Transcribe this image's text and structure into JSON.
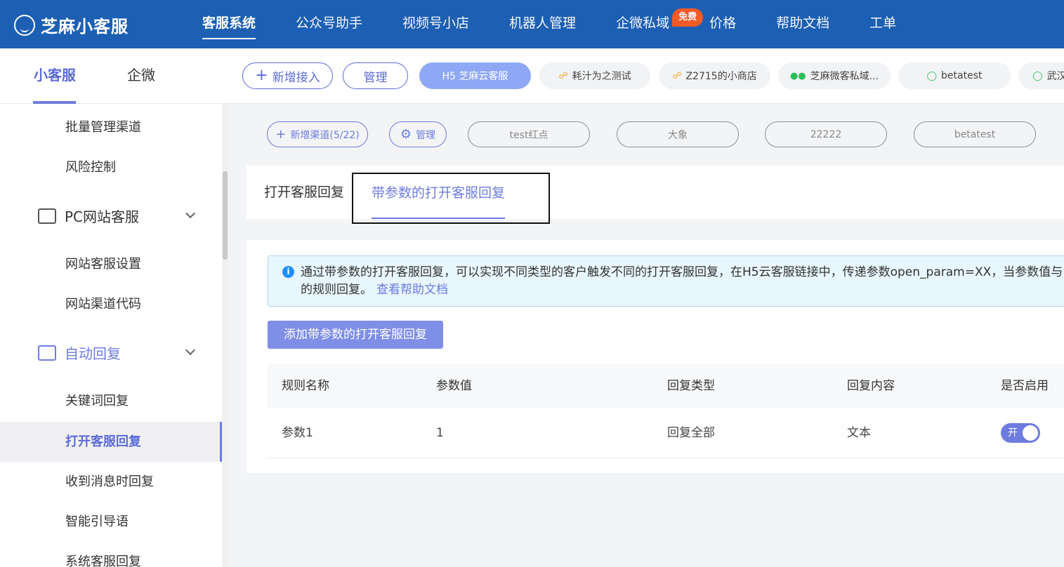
{
  "brand": {
    "name": "芝麻小客服"
  },
  "topnav": [
    {
      "label": "客服系统",
      "active": true
    },
    {
      "label": "公众号助手"
    },
    {
      "label": "视频号小店"
    },
    {
      "label": "机器人管理"
    },
    {
      "label": "企微私域",
      "badge": "免费"
    },
    {
      "label": "价格"
    },
    {
      "label": "帮助文档"
    },
    {
      "label": "工单"
    }
  ],
  "product_tabs": [
    "小客服",
    "企微"
  ],
  "accounts": {
    "add_label": "新增接入",
    "manage_label": "管理",
    "items": [
      "H5 芝麻云客服",
      "耗汁为之测试",
      "Z2715的小商店",
      "芝麻微客私域...",
      "betatest",
      "武汉"
    ]
  },
  "sidebar": {
    "items": [
      {
        "label": "批量管理渠道"
      },
      {
        "label": "风险控制"
      },
      {
        "label": "PC网站客服",
        "group": true,
        "icon": "website-icon"
      },
      {
        "label": "网站客服设置"
      },
      {
        "label": "网站渠道代码"
      },
      {
        "label": "自动回复",
        "group": true,
        "icon": "message-icon"
      },
      {
        "label": "关键词回复"
      },
      {
        "label": "打开客服回复",
        "active": true
      },
      {
        "label": "收到消息时回复"
      },
      {
        "label": "智能引导语"
      },
      {
        "label": "系统客服回复"
      }
    ]
  },
  "channels": {
    "add_label": "新增渠道(5/22)",
    "manage_label": "管理",
    "items": [
      "test红点",
      "大象",
      "22222",
      "betatest"
    ]
  },
  "reply_tabs": [
    "打开客服回复",
    "带参数的打开客服回复"
  ],
  "info": {
    "text": "通过带参数的打开客服回复，可以实现不同类型的客户触发不同的打开客服回复，在H5云客服链接中，传递参数open_param=XX，当参数值与",
    "text2": "的规则回复。",
    "link": "查看帮助文档"
  },
  "add_button": "添加带参数的打开客服回复",
  "table": {
    "headers": [
      "规则名称",
      "参数值",
      "回复类型",
      "回复内容",
      "是否启用"
    ],
    "rows": [
      {
        "name": "参数1",
        "param": "1",
        "type": "回复全部",
        "content": "文本",
        "enabled_label": "开"
      }
    ]
  }
}
